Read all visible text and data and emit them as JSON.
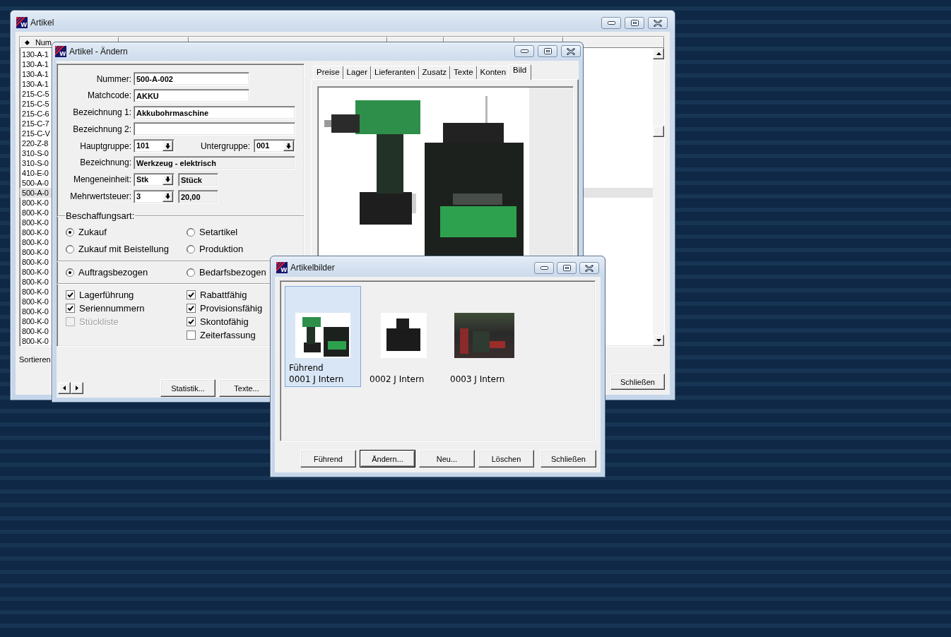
{
  "article_window": {
    "logo": "w",
    "title": "Artikel",
    "columns": [
      {
        "label": "Num",
        "sorted": true
      }
    ],
    "rows": [
      {
        "text": "130-A-1",
        "selected": false
      },
      {
        "text": "130-A-1",
        "selected": false
      },
      {
        "text": "130-A-1",
        "selected": false
      },
      {
        "text": "130-A-1",
        "selected": false
      },
      {
        "text": "215-C-5",
        "selected": false
      },
      {
        "text": "215-C-5",
        "selected": false
      },
      {
        "text": "215-C-6",
        "selected": false
      },
      {
        "text": "215-C-7",
        "selected": false
      },
      {
        "text": "215-C-V",
        "selected": false
      },
      {
        "text": "220-Z-8",
        "selected": false
      },
      {
        "text": "310-S-0",
        "selected": false
      },
      {
        "text": "310-S-0",
        "selected": false
      },
      {
        "text": "410-E-0",
        "selected": false
      },
      {
        "text": "500-A-0",
        "selected": false
      },
      {
        "text": "500-A-0",
        "selected": true
      },
      {
        "text": "800-K-0",
        "selected": false
      },
      {
        "text": "800-K-0",
        "selected": false
      },
      {
        "text": "800-K-0",
        "selected": false
      },
      {
        "text": "800-K-0",
        "selected": false
      },
      {
        "text": "800-K-0",
        "selected": false
      },
      {
        "text": "800-K-0",
        "selected": false
      },
      {
        "text": "800-K-0",
        "selected": false
      },
      {
        "text": "800-K-0",
        "selected": false
      },
      {
        "text": "800-K-0",
        "selected": false
      },
      {
        "text": "800-K-0",
        "selected": false
      },
      {
        "text": "800-K-0",
        "selected": false
      },
      {
        "text": "800-K-0",
        "selected": false
      },
      {
        "text": "800-K-0",
        "selected": false
      },
      {
        "text": "800-K-0",
        "selected": false
      },
      {
        "text": "800-K-0",
        "selected": false
      }
    ],
    "sort_label": "Sortieren",
    "close_button": "Schließen"
  },
  "edit_window": {
    "logo": "w",
    "title": "Artikel - Ändern",
    "fields": {
      "nummer": {
        "label": "Nummer:",
        "value": "500-A-002"
      },
      "matchcode": {
        "label": "Matchcode:",
        "value": "AKKU"
      },
      "bezeichnung_1": {
        "label": "Bezeichnung 1:",
        "value": "Akkubohrmaschine"
      },
      "bezeichnung_2": {
        "label": "Bezeichnung 2:"
      },
      "hauptgruppe": {
        "label": "Hauptgruppe:",
        "value": "101"
      },
      "untergruppe": {
        "label": "Untergruppe:",
        "value": "001"
      },
      "gruppe_bezeichnung": {
        "label": "Bezeichnung:",
        "value": "Werkzeug - elektrisch"
      },
      "mengeneinheit": {
        "label": "Mengeneinheit:",
        "value": "Stk",
        "description": "Stück"
      },
      "mehrwertsteuer": {
        "label": "Mehrwertsteuer:",
        "value": "3",
        "description": "20,00"
      }
    },
    "procurement": {
      "label": "Beschaffungsart:",
      "options": [
        {
          "label": "Zukauf",
          "selected": true
        },
        {
          "label": "Setartikel",
          "selected": false
        },
        {
          "label": "Zukauf mit Beistellung",
          "selected": false
        },
        {
          "label": "Produktion",
          "selected": false
        }
      ]
    },
    "reference": {
      "options": [
        {
          "label": "Auftragsbezogen",
          "selected": true
        },
        {
          "label": "Bedarfsbezogen",
          "selected": false
        }
      ]
    },
    "flags_left": [
      {
        "label": "Lagerführung",
        "checked": true,
        "disabled": false
      },
      {
        "label": "Seriennummern",
        "checked": true,
        "disabled": false
      },
      {
        "label": "Stückliste",
        "checked": false,
        "disabled": true
      }
    ],
    "flags_right": [
      {
        "label": "Rabattfähig",
        "checked": true,
        "disabled": false
      },
      {
        "label": "Provisionsfähig",
        "checked": true,
        "disabled": false
      },
      {
        "label": "Skontofähig",
        "checked": true,
        "disabled": false
      },
      {
        "label": "Zeiterfassung",
        "checked": false,
        "disabled": false
      }
    ],
    "buttons": [
      {
        "label": "Statistik..."
      },
      {
        "label": "Texte..."
      }
    ],
    "tabs": [
      {
        "label": "Preise",
        "selected": false
      },
      {
        "label": "Lager",
        "selected": false
      },
      {
        "label": "Lieferanten",
        "selected": false
      },
      {
        "label": "Zusatz",
        "selected": false
      },
      {
        "label": "Texte",
        "selected": false
      },
      {
        "label": "Konten",
        "selected": false
      },
      {
        "label": "Bild",
        "selected": true
      }
    ]
  },
  "images_window": {
    "logo": "w",
    "title": "Artikelbilder",
    "images": [
      {
        "tag": "Führend",
        "caption": "0001 J Intern",
        "selected": true
      },
      {
        "caption": "0002 J Intern",
        "selected": false
      },
      {
        "caption": "0003 J Intern",
        "selected": false
      }
    ],
    "buttons": [
      {
        "label": "Führend",
        "focused": false
      },
      {
        "label": "Ändern...",
        "focused": true
      },
      {
        "label": "Neu...",
        "focused": false
      },
      {
        "label": "Löschen",
        "focused": false
      },
      {
        "label": "Schließen",
        "focused": false
      }
    ]
  }
}
